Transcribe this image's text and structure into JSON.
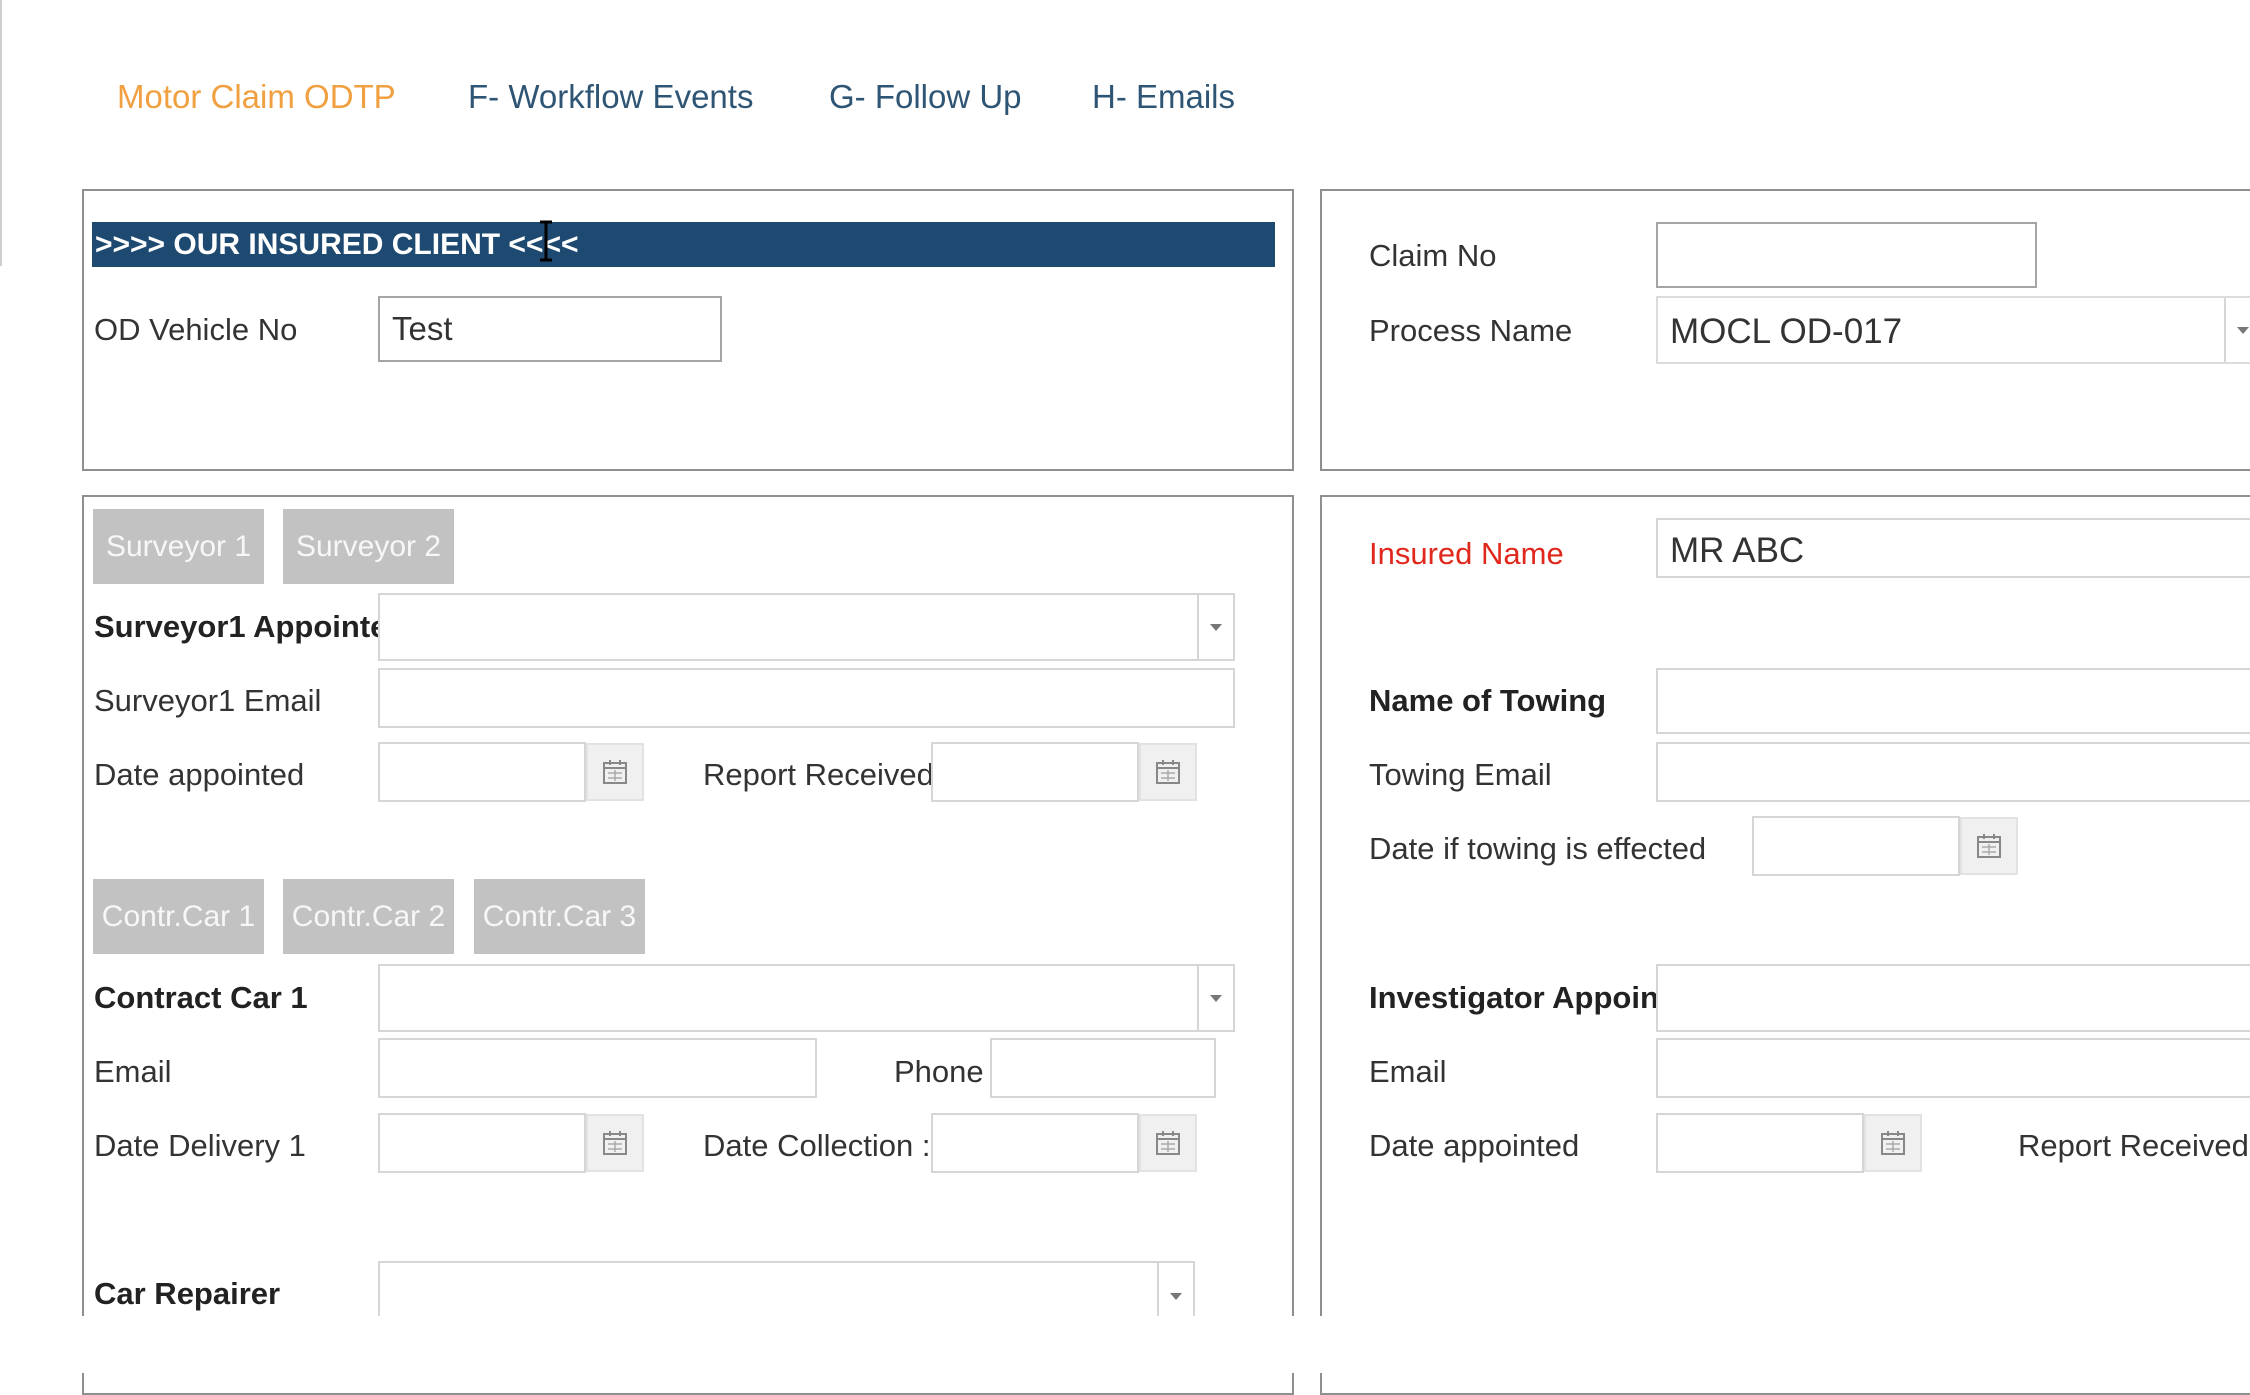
{
  "tabs": [
    {
      "label": "Motor Claim ODTP",
      "active": true
    },
    {
      "label": "F- Workflow Events",
      "active": false
    },
    {
      "label": "G- Follow Up",
      "active": false
    },
    {
      "label": "H- Emails",
      "active": false
    }
  ],
  "colors": {
    "accent": "#f0a040",
    "header": "#1e4a72",
    "required": "#e0281c",
    "tab": "#2f5575"
  },
  "insured_panel": {
    "header": ">>>> OUR INSURED CLIENT <<<<",
    "od_vehicle_label": "OD Vehicle No",
    "od_vehicle_value": "Test"
  },
  "claim_panel": {
    "claim_no_label": "Claim No",
    "claim_no_value": "",
    "process_label": "Process Name",
    "process_value": "MOCL OD-017"
  },
  "surveyor": {
    "tabs": [
      "Surveyor 1",
      "Surveyor 2"
    ],
    "appointed_label": "Surveyor1 Appointe",
    "email_label": "Surveyor1 Email",
    "date_appointed_label": "Date appointed",
    "report_received_label": "Report Received"
  },
  "contract_car": {
    "tabs": [
      "Contr.Car 1",
      "Contr.Car 2",
      "Contr.Car 3"
    ],
    "car_label": "Contract Car 1",
    "email_label": "Email",
    "phone_label": "Phone",
    "delivery_label": "Date Delivery 1",
    "collection_label": "Date Collection :"
  },
  "car_repairer_label": "Car Repairer",
  "right": {
    "insured_name_label": "Insured Name",
    "insured_name_value": "MR ABC",
    "towing_name_label": "Name of Towing",
    "towing_email_label": "Towing Email",
    "towing_date_label": "Date if towing is effected",
    "investigator_label": "Investigator Appoint",
    "email_label": "Email",
    "date_appointed_label": "Date appointed",
    "report_received_label": "Report Received"
  },
  "icons": {
    "calendar": "calendar-icon",
    "dropdown": "chevron-down-icon"
  }
}
